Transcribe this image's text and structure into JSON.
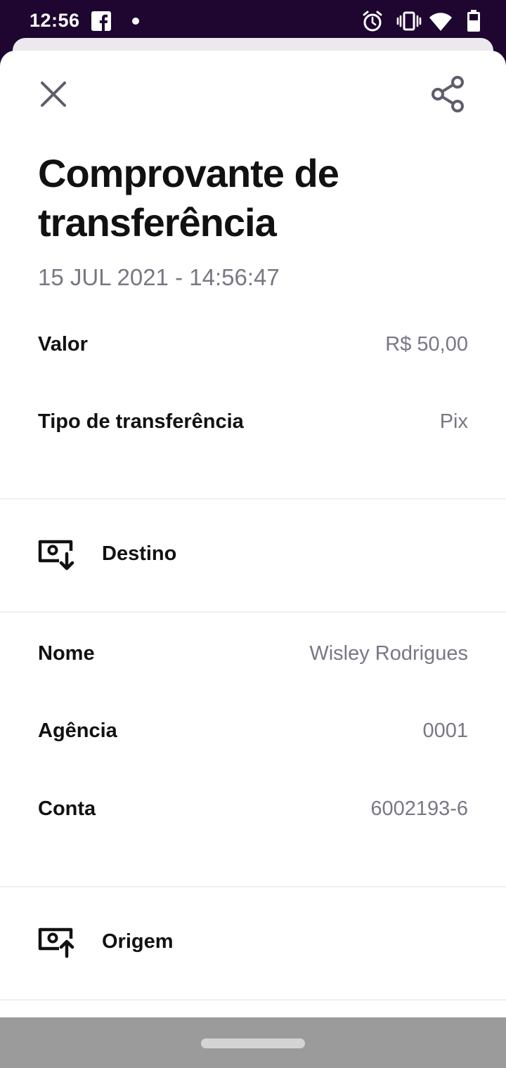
{
  "status_bar": {
    "time": "12:56",
    "icons": [
      "facebook-icon",
      "notification-dot-icon",
      "alarm-icon",
      "vibrate-icon",
      "wifi-icon",
      "battery-icon"
    ]
  },
  "header": {
    "close_icon": "close-icon",
    "share_icon": "share-icon"
  },
  "receipt": {
    "title": "Comprovante de transferência",
    "datetime": "15 JUL 2021 - 14:56:47",
    "value_label": "Valor",
    "value": "R$ 50,00",
    "type_label": "Tipo de transferência",
    "type": "Pix"
  },
  "destination": {
    "label": "Destino",
    "icon": "account-download-icon",
    "name_label": "Nome",
    "name": "Wisley Rodrigues",
    "agency_label": "Agência",
    "agency": "0001",
    "account_label": "Conta",
    "account": "6002193-6"
  },
  "origin": {
    "label": "Origem",
    "icon": "account-upload-icon"
  },
  "colors": {
    "status_bar": "#1e0631",
    "text_primary": "#111111",
    "text_secondary": "#7a7784",
    "icon_gray": "#5f5d6b",
    "nav_bar": "#9b9b9b"
  }
}
